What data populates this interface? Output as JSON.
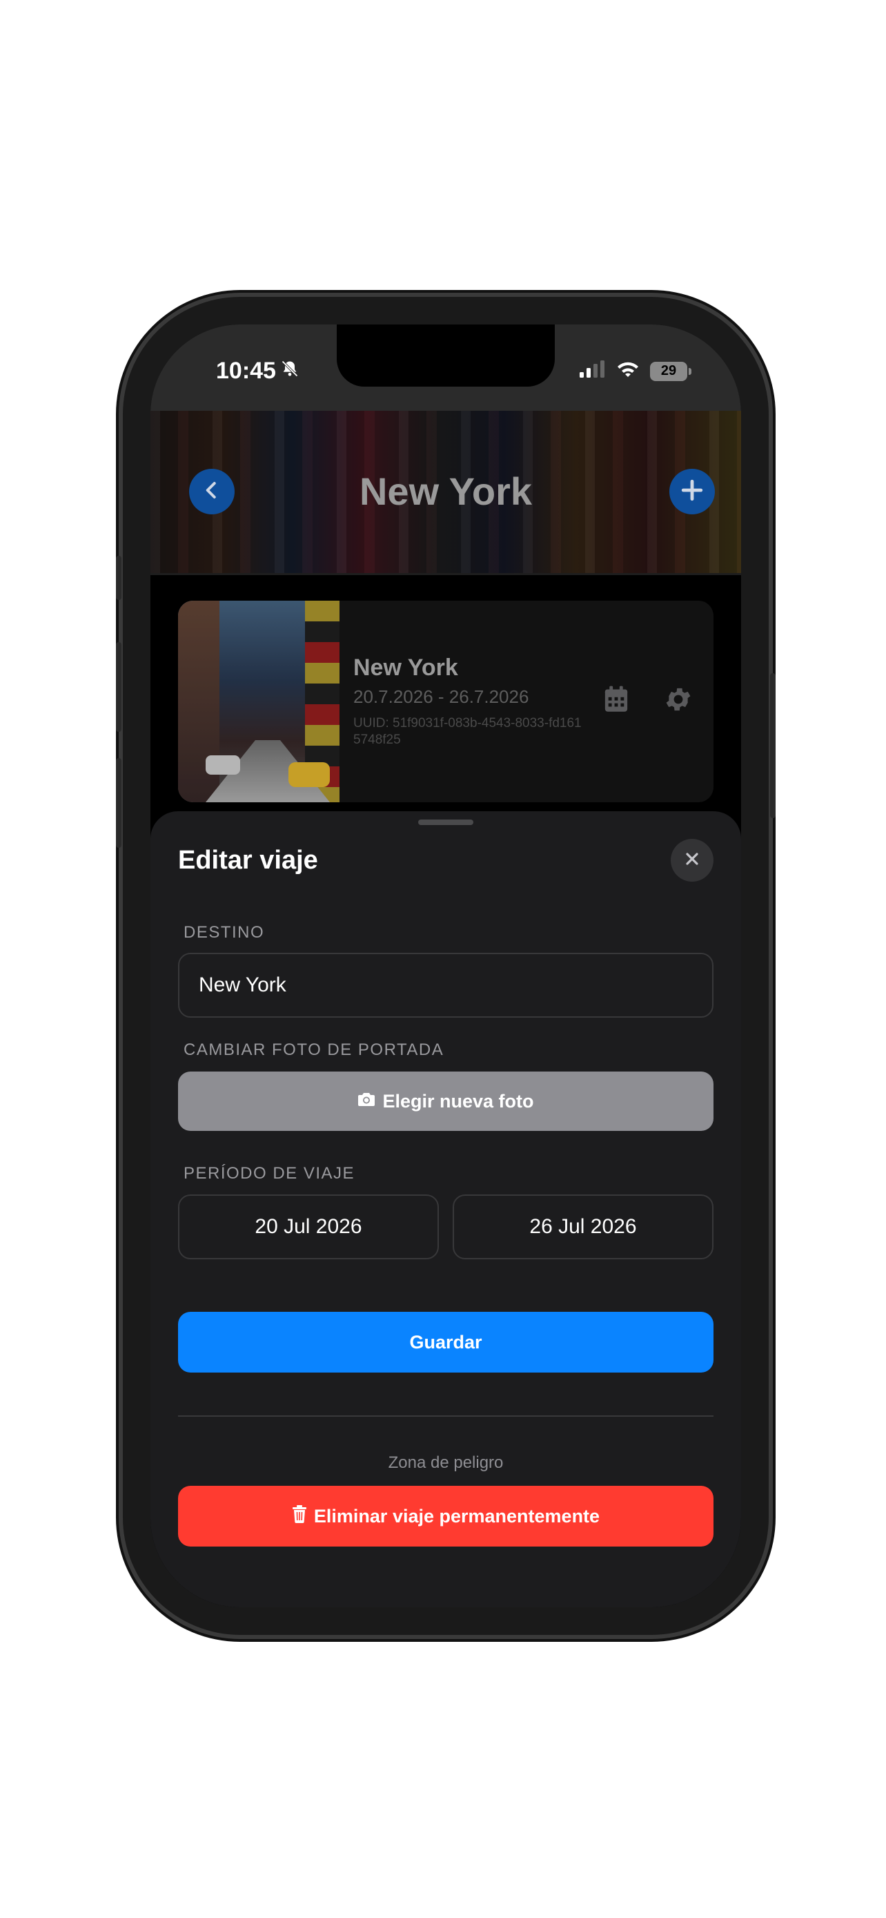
{
  "status_bar": {
    "time": "10:45",
    "battery": "29"
  },
  "header": {
    "title": "New York"
  },
  "trip_card": {
    "title": "New York",
    "dates": "20.7.2026 - 26.7.2026",
    "uuid": "UUID: 51f9031f-083b-4543-8033-fd1615748f25"
  },
  "sheet": {
    "title": "Editar viaje",
    "destination_label": "DESTINO",
    "destination_value": "New York",
    "photo_label": "CAMBIAR FOTO DE PORTADA",
    "photo_button": "Elegir nueva foto",
    "period_label": "PERÍODO DE VIAJE",
    "start_date": "20 Jul 2026",
    "end_date": "26 Jul 2026",
    "save_button": "Guardar",
    "danger_label": "Zona de peligro",
    "delete_button": "Eliminar viaje permanentemente"
  },
  "colors": {
    "accent": "#0a84ff",
    "danger": "#ff3b30",
    "secondary_button": "#8e8e93"
  }
}
